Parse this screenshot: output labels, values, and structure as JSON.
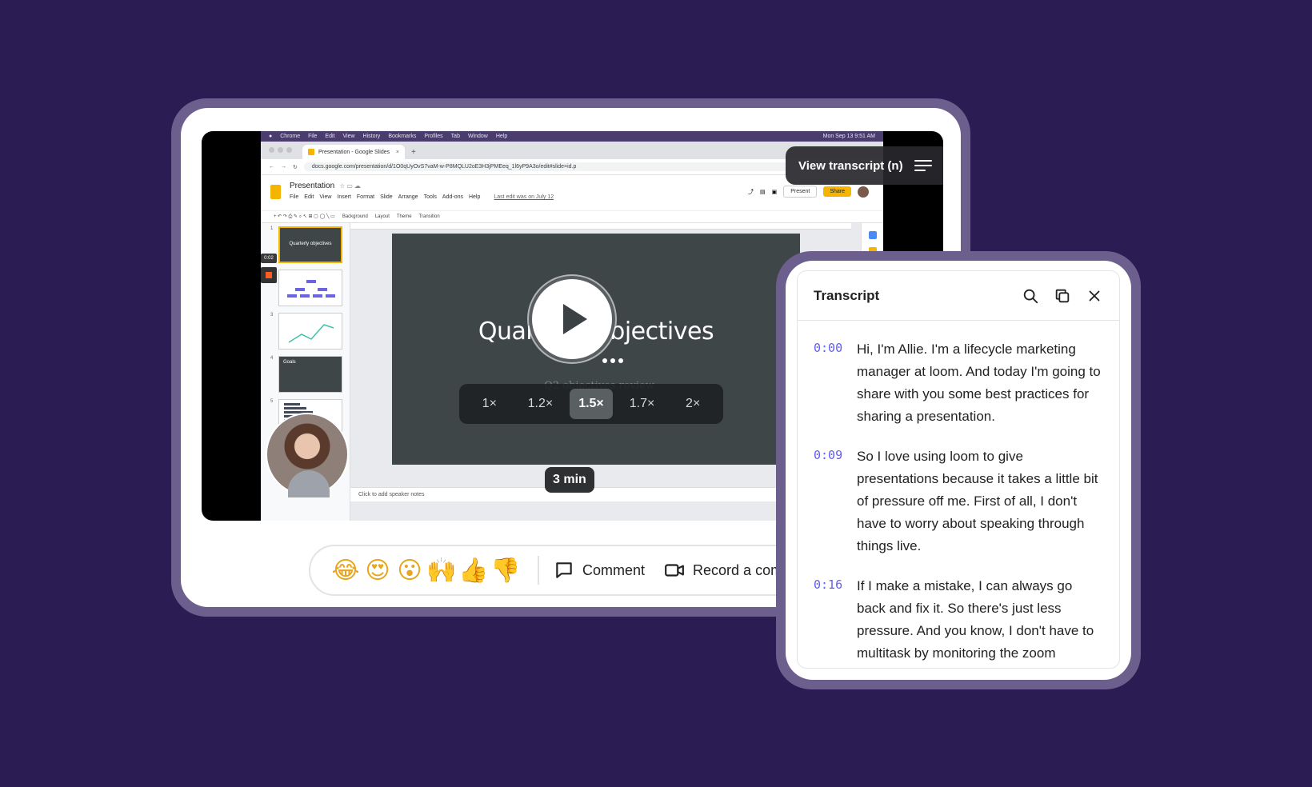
{
  "screen": {
    "mac_menu": [
      "Chrome",
      "File",
      "Edit",
      "View",
      "History",
      "Bookmarks",
      "Profiles",
      "Tab",
      "Window",
      "Help"
    ],
    "mac_clock": "Mon Sep 13  9:51 AM",
    "browser_tab": "Presentation - Google Slides",
    "url": "docs.google.com/presentation/d/1O0qUyOvS7vaM-w-P8MQLU2oE3H3jPMEeq_1l6yP9A3o/edit#slide=id.p",
    "doc_title": "Presentation",
    "doc_menu": [
      "File",
      "Edit",
      "View",
      "Insert",
      "Format",
      "Slide",
      "Arrange",
      "Tools",
      "Add-ons",
      "Help"
    ],
    "last_edit": "Last edit was on July 12",
    "present_label": "Present",
    "share_label": "Share",
    "toolbar_items": [
      "Background",
      "Layout",
      "Theme",
      "Transition"
    ],
    "thumb1_title": "Quarterly objectives",
    "thumb4_title": "Goals",
    "slide_title": "Quarterly objectives",
    "slide_subtitle": "Q2 objectives review",
    "speaker_notes": "Click to add speaker notes",
    "rec_time": "0:02"
  },
  "player": {
    "view_transcript": "View transcript (n)",
    "speeds": [
      "1×",
      "1.2×",
      "1.5×",
      "1.7×",
      "2×"
    ],
    "active_speed": "1.5×",
    "duration": "3 min"
  },
  "reactions": {
    "emojis": [
      "😂",
      "😍",
      "😮",
      "🙌",
      "👍",
      "👎"
    ],
    "comment": "Comment",
    "record": "Record a comm"
  },
  "transcript": {
    "title": "Transcript",
    "entries": [
      {
        "time": "0:00",
        "text": "Hi, I'm Allie. I'm a lifecycle marketing manager at loom. And today I'm going to share with you some best practices for sharing a presentation."
      },
      {
        "time": "0:09",
        "text": "So I love using loom to give presentations because it takes a little bit of pressure off me. First of all, I don't have to worry about speaking through things live."
      },
      {
        "time": "0:16",
        "text": "If I make a mistake, I can always go back and fix it. So there's just less pressure. And you know, I don't have to multitask by monitoring the zoom"
      }
    ]
  },
  "colors": {
    "background": "#2b1d53",
    "frame": "#6c5f8e",
    "timestamp": "#625df5",
    "slide_bg": "#3e4648",
    "google_yellow": "#f4b400"
  }
}
